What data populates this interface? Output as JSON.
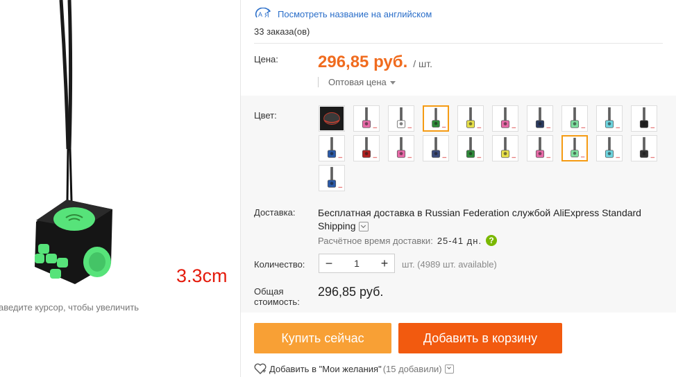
{
  "gallery": {
    "size_label": "3.3cm",
    "zoom_hint": "аведите курсор, чтобы увеличить"
  },
  "product": {
    "translate_link": "Посмотреть название на английском",
    "translate_icon": "translate-icon",
    "orders": "33 заказа(ов)"
  },
  "price": {
    "label": "Цена:",
    "value": "296,85 руб.",
    "unit": "/ шт.",
    "wholesale": "Оптовая цена",
    "color": "#f06b1e"
  },
  "color": {
    "label": "Цвет:",
    "swatches": [
      {
        "accent": "#222222",
        "kind": "box"
      },
      {
        "accent": "#e86aa8"
      },
      {
        "accent": "#ffffff"
      },
      {
        "accent": "#2f8a3a",
        "selected": true
      },
      {
        "accent": "#e8e14a"
      },
      {
        "accent": "#e86aa8"
      },
      {
        "accent": "#2a3a5e"
      },
      {
        "accent": "#7fe0a0"
      },
      {
        "accent": "#6fd6e0"
      },
      {
        "accent": "#222222"
      },
      {
        "accent": "#2a5aa8"
      },
      {
        "accent": "#b02020"
      },
      {
        "accent": "#e86aa8"
      },
      {
        "accent": "#3a4a7a"
      },
      {
        "accent": "#2f8a3a"
      },
      {
        "accent": "#e8e14a"
      },
      {
        "accent": "#e86aa8"
      },
      {
        "accent": "#7fe0a0",
        "selected": true
      },
      {
        "accent": "#6fd6e0"
      },
      {
        "accent": "#333333"
      },
      {
        "accent": "#2a5aa8"
      }
    ]
  },
  "shipping": {
    "label": "Доставка:",
    "text": "Бесплатная доставка в Russian Federation службой AliExpress Standard Shipping",
    "eta_label": "Расчётное время доставки:",
    "eta_value": "25-41 дн.",
    "help": "?"
  },
  "quantity": {
    "label": "Количество:",
    "minus": "−",
    "value": "1",
    "plus": "+",
    "available": "шт. (4989 шт. available)"
  },
  "total": {
    "label_line1": "Общая",
    "label_line2": "стоимость:",
    "value": "296,85 руб."
  },
  "actions": {
    "buy_now": "Купить сейчас",
    "add_to_cart": "Добавить в корзину",
    "buy_color": "#f8a035",
    "cart_color": "#f25a0f"
  },
  "wishlist": {
    "text": "Добавить в \"Мои желания\"",
    "count": "(15 добавили)"
  }
}
